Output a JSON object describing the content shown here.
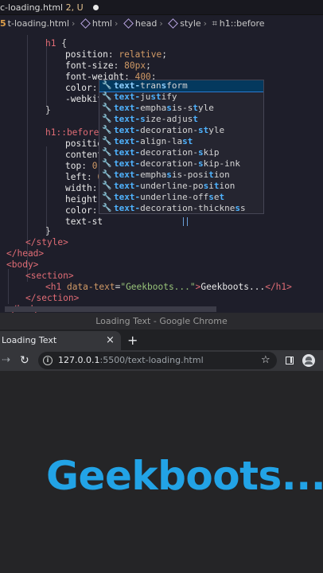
{
  "editor": {
    "tab": {
      "filename": "c-loading.html",
      "status": "2, U"
    },
    "breadcrumb": [
      "html",
      "head",
      "style",
      "h1::before"
    ],
    "breadcrumb_file": "t-loading.html",
    "code_lines": [
      "    h1 {",
      "        position: relative;",
      "        font-size: 80px;",
      "        font-weight: 400;",
      "        color:",
      "        -webkit",
      "    }",
      "",
      "    h1::before",
      "        positio",
      "        content",
      "        top: 0;",
      "        left: 0",
      "        width:",
      "        height:",
      "        color:",
      "        text-st",
      "    }",
      "  </style>",
      "</head>",
      "<body>",
      "    <section>",
      "        <h1 data-text=\"Geekboots...\">Geekboots...</h1>",
      "    </section>",
      "</body>"
    ],
    "suggestions": [
      "text-transform",
      "text-justify",
      "text-emphasis-style",
      "text-size-adjust",
      "text-decoration-style",
      "text-align-last",
      "text-decoration-skip",
      "text-decoration-skip-ink",
      "text-emphasis-position",
      "text-underline-position",
      "text-underline-offset",
      "text-decoration-thickness"
    ]
  },
  "chrome": {
    "window_title": "Loading Text - Google Chrome",
    "tab_title": "Loading Text",
    "tab_close": "×",
    "new_tab": "+",
    "url_host": "127.0.0.1",
    "url_rest": ":5500/text-loading.html",
    "page_heading": "Geekboots..."
  },
  "colors": {
    "heading": "#22a3e6",
    "suggest_match": "#4fb3ff",
    "selector": "#e06c75",
    "value": "#d19a66",
    "string": "#98c379"
  },
  "icons": [
    "search-icon",
    "info-icon",
    "star-icon",
    "side-panel-icon",
    "profile-icon",
    "back-icon",
    "reload-icon",
    "wrench-icon"
  ]
}
